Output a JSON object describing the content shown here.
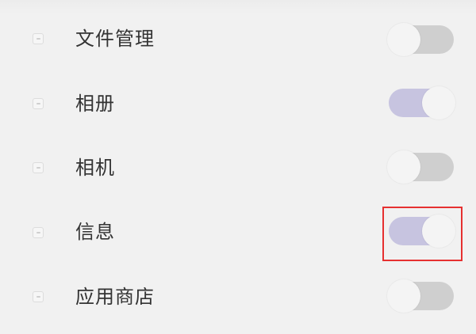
{
  "settings_list": {
    "items": [
      {
        "label": "文件管理",
        "icon": "file-manager-icon",
        "enabled": false
      },
      {
        "label": "相册",
        "icon": "photos-icon",
        "enabled": true
      },
      {
        "label": "相机",
        "icon": "camera-icon",
        "enabled": false
      },
      {
        "label": "信息",
        "icon": "messages-icon",
        "enabled": true,
        "highlighted": true
      },
      {
        "label": "应用商店",
        "icon": "app-store-icon",
        "enabled": false
      }
    ]
  },
  "colors": {
    "background": "#f1f1f1",
    "toggle_on": "#c7c4e0",
    "toggle_off": "#cfcfcf",
    "knob": "#f4f4f4",
    "highlight": "#e63030",
    "label_text": "#333333"
  }
}
